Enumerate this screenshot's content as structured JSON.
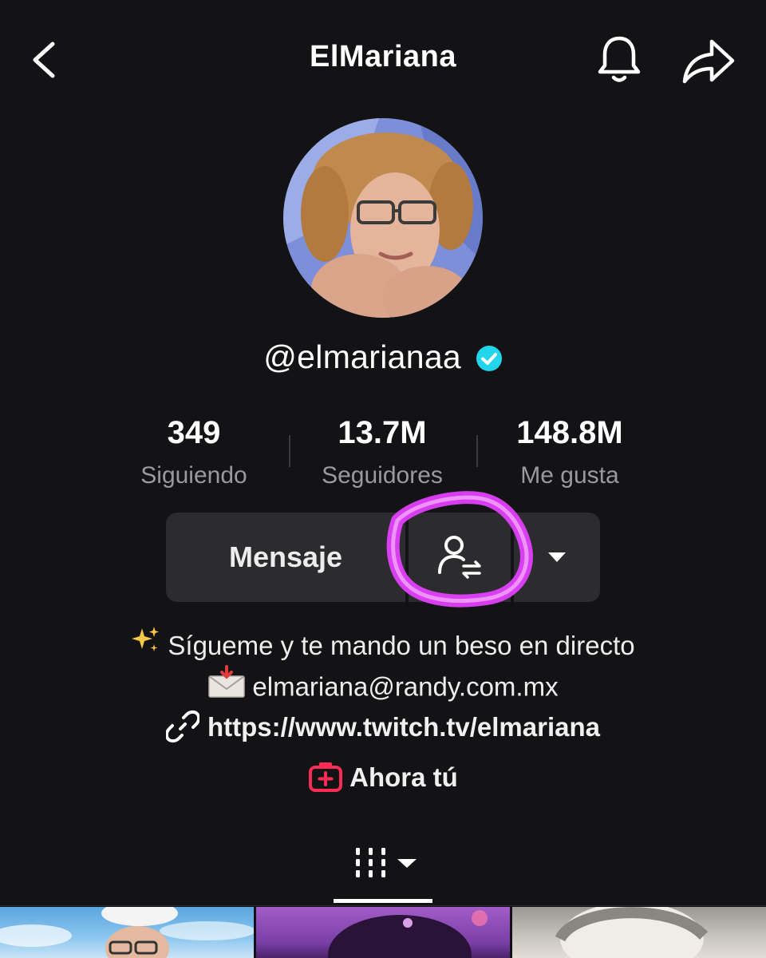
{
  "header": {
    "title": "ElMariana",
    "back_icon": "chevron-left-icon",
    "bell_icon": "bell-icon",
    "share_icon": "share-arrow-icon"
  },
  "profile": {
    "username": "@elmarianaa",
    "verified": true,
    "verified_color": "#20d5ec"
  },
  "stats": [
    {
      "value": "349",
      "label": "Siguiendo"
    },
    {
      "value": "13.7M",
      "label": "Seguidores"
    },
    {
      "value": "148.8M",
      "label": "Me gusta"
    }
  ],
  "actions": {
    "message_label": "Mensaje",
    "follow_icon": "user-swap-icon",
    "dropdown_icon": "caret-down-icon",
    "highlight_color": "#e040fb"
  },
  "bio": {
    "line1": "Sígueme y te mando un beso en directo",
    "line1_icon": "sparkles-icon",
    "line2": "elmariana@randy.com.mx",
    "line2_icon": "envelope-icon",
    "link": "https://www.twitch.tv/elmariana",
    "link_icon": "link-icon",
    "extra": "Ahora tú",
    "extra_icon": "plus-box-icon",
    "extra_icon_color": "#fe2c55"
  },
  "tabs": {
    "grid_icon": "grid-columns-icon",
    "grid_dropdown_icon": "caret-down-icon"
  }
}
